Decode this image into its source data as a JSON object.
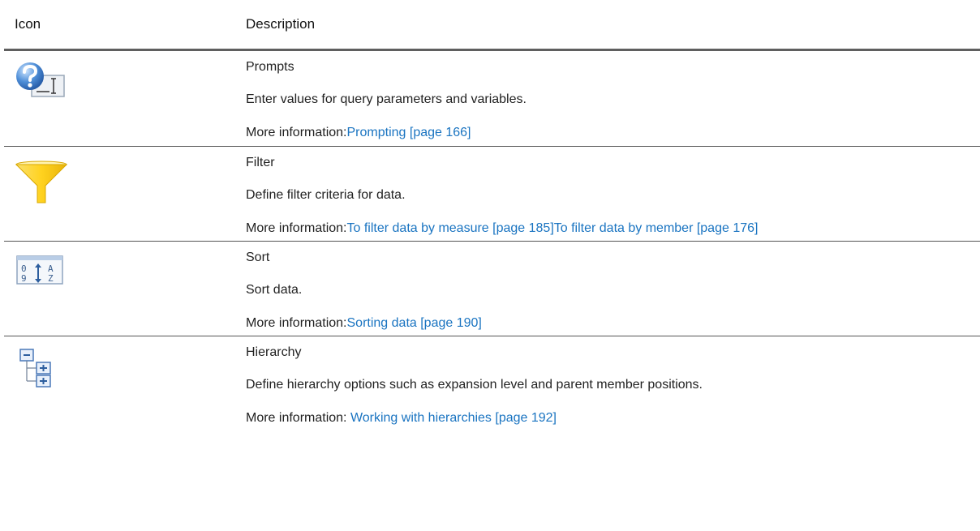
{
  "header": {
    "icon_col": "Icon",
    "desc_col": "Description"
  },
  "rows": [
    {
      "icon": "prompts-icon",
      "title": "Prompts",
      "text": "Enter values for query parameters and variables.",
      "more_label": "More information:",
      "links": [
        "Prompting [page 166]"
      ]
    },
    {
      "icon": "filter-funnel-icon",
      "title": "Filter",
      "text": "Define filter criteria for data.",
      "more_label": "More information:",
      "links": [
        "To filter data by measure [page 185]",
        "To filter data by member [page 176]"
      ]
    },
    {
      "icon": "sort-icon",
      "title": "Sort",
      "text": "Sort data.",
      "more_label": "More information:",
      "links": [
        "Sorting data [page 190]"
      ]
    },
    {
      "icon": "hierarchy-icon",
      "title": "Hierarchy",
      "text": "Define hierarchy options such as expansion level and parent member positions.",
      "more_label": "More information: ",
      "links": [
        "Working with hierarchies [page 192]"
      ]
    }
  ],
  "colors": {
    "link": "#1a74c1",
    "text": "#222222",
    "rule": "#555555"
  }
}
